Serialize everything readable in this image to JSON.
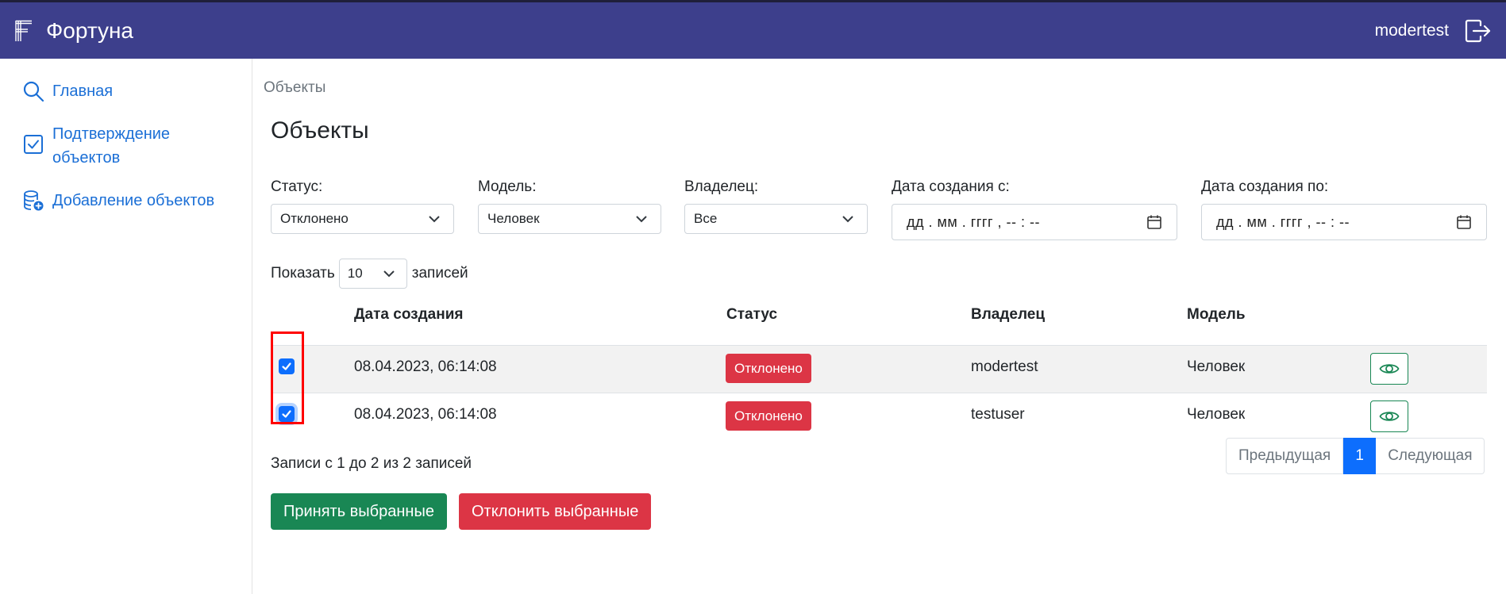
{
  "header": {
    "brand": "Фортуна",
    "user": "modertest",
    "logout_icon": "logout-icon"
  },
  "sidebar": {
    "items": [
      {
        "label": "Главная",
        "icon": "search-icon"
      },
      {
        "label": "Подтверждение объектов",
        "icon": "checkbox-icon"
      },
      {
        "label": "Добавление объектов",
        "icon": "database-add-icon"
      }
    ]
  },
  "main": {
    "breadcrumb": "Объекты",
    "title": "Объекты",
    "filters": {
      "status": {
        "label": "Статус:",
        "value": "Отклонено"
      },
      "model": {
        "label": "Модель:",
        "value": "Человек"
      },
      "owner": {
        "label": "Владелец:",
        "value": "Все"
      },
      "date_from": {
        "label": "Дата создания с:",
        "value": "дд . мм . гггг ,  -- : --"
      },
      "date_to": {
        "label": "Дата создания по:",
        "value": "дд . мм . гггг ,  -- : --"
      }
    },
    "length": {
      "prefix": "Показать",
      "value": "10",
      "suffix": "записей"
    },
    "table": {
      "columns": [
        "Дата создания",
        "Статус",
        "Владелец",
        "Модель"
      ],
      "rows": [
        {
          "checked": true,
          "date": "08.04.2023, 06:14:08",
          "status": "Отклонено",
          "owner": "modertest",
          "model": "Человек"
        },
        {
          "checked": true,
          "date": "08.04.2023, 06:14:08",
          "status": "Отклонено",
          "owner": "testuser",
          "model": "Человек"
        }
      ]
    },
    "info": "Записи с 1 до 2 из 2 записей",
    "pagination": {
      "prev": "Предыдущая",
      "current": "1",
      "next": "Следующая"
    },
    "actions": {
      "accept": "Принять выбранные",
      "reject": "Отклонить выбранные"
    }
  },
  "colors": {
    "header_bg": "#3d3f8c",
    "link": "#1b6fd6",
    "primary": "#0d6efd",
    "success": "#198754",
    "danger": "#dc3545",
    "highlight": "#ff0000"
  }
}
